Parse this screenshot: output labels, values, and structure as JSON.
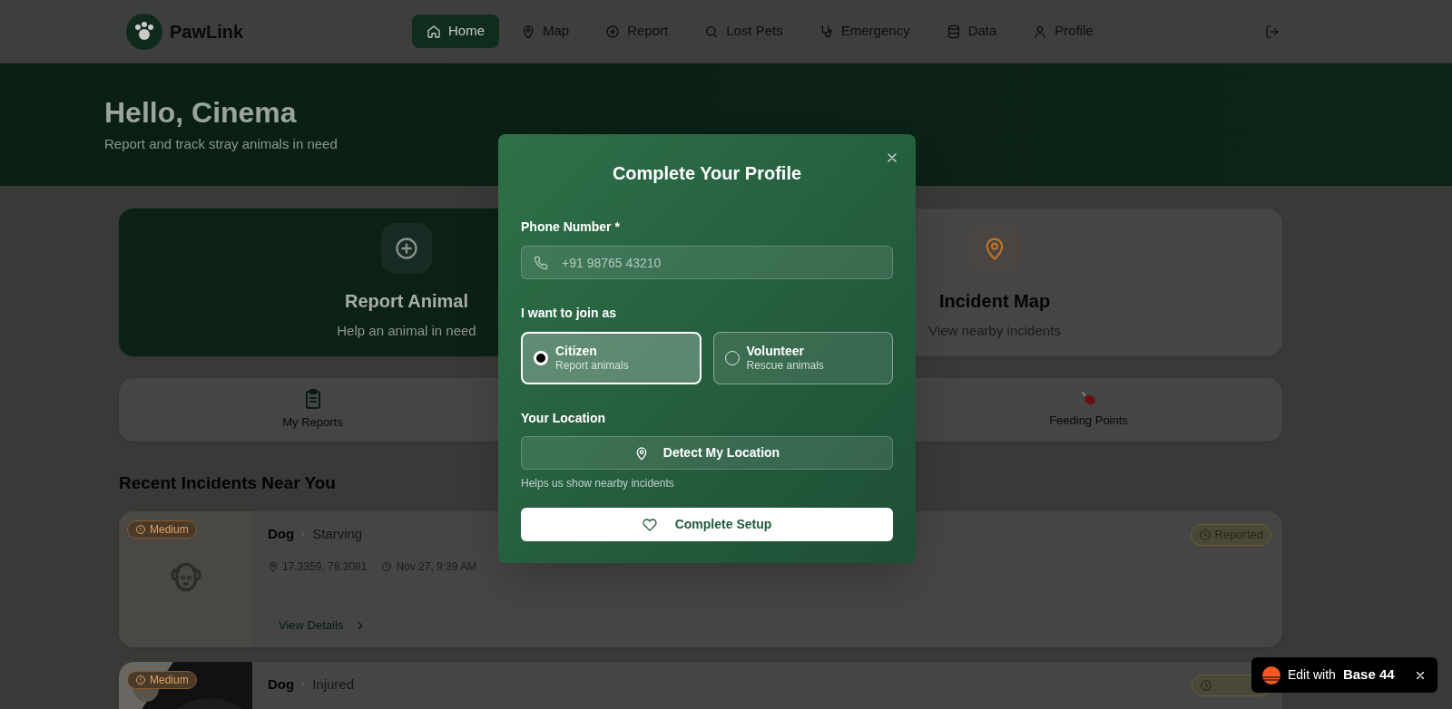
{
  "app": {
    "name": "PawLink"
  },
  "nav": [
    {
      "label": "Home",
      "selected": true
    },
    {
      "label": "Map",
      "selected": false
    },
    {
      "label": "Report",
      "selected": false
    },
    {
      "label": "Lost Pets",
      "selected": false
    },
    {
      "label": "Emergency",
      "selected": false
    },
    {
      "label": "Data",
      "selected": false
    },
    {
      "label": "Profile",
      "selected": false
    }
  ],
  "hero": {
    "title": "Hello, Cinema",
    "subtitle": "Report and track stray animals in need"
  },
  "action_cards": [
    {
      "kind": "primary",
      "title": "Report Animal",
      "subtitle": "Help an animal in need"
    },
    {
      "kind": "plain",
      "title": "Incident Map",
      "subtitle": "View nearby incidents"
    }
  ],
  "quick_links": [
    {
      "label": "My Reports"
    },
    {
      "label": "Feeding Points"
    }
  ],
  "incidents_heading": "Recent Incidents Near You",
  "incidents": [
    {
      "kind": "placeholder",
      "severity": "Medium",
      "animal": "Dog",
      "condition": "Starving",
      "location": "17.3359, 78.3081",
      "time": "Nov 27, 9:39 AM",
      "status": "Reported",
      "link": "View Details"
    },
    {
      "kind": "picture",
      "severity": "Medium",
      "animal": "Dog",
      "condition": "Injured"
    }
  ],
  "modal": {
    "title": "Complete Your Profile",
    "phone_label": "Phone Number *",
    "phone_placeholder": "+91 98765 43210",
    "role_label": "I want to join as",
    "roles": [
      {
        "title": "Citizen",
        "subtitle": "Report animals",
        "selected": true
      },
      {
        "title": "Volunteer",
        "subtitle": "Rescue animals",
        "selected": false
      }
    ],
    "location_label": "Your Location",
    "location_button": "Detect My Location",
    "location_hint": "Helps us show nearby incidents",
    "submit": "Complete Setup"
  },
  "badge": {
    "prefix": "Edit with",
    "brand": "Base 44"
  }
}
